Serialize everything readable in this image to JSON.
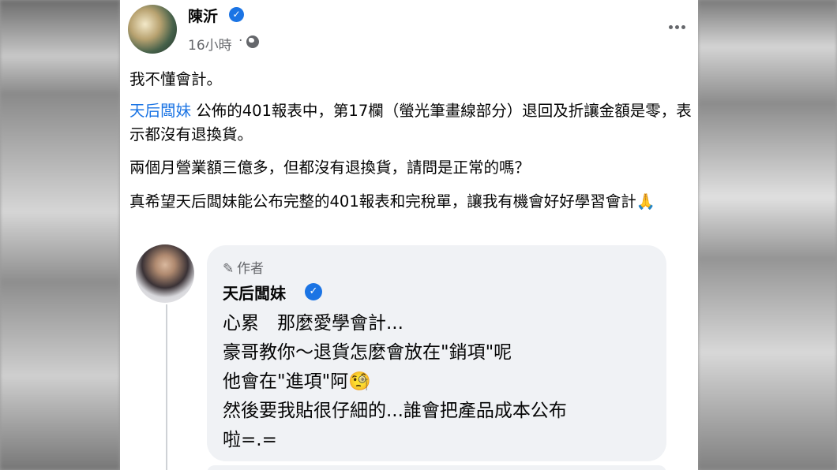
{
  "post": {
    "author": "陳沂",
    "timestamp": "16小時",
    "separator": "·",
    "verified_icon": "verified-check-icon",
    "privacy_icon": "globe-icon",
    "more_icon": "more-options-icon",
    "paragraphs": {
      "p1": "我不懂會計。",
      "p2_mention": "天后闆妹",
      "p2_rest": " 公佈的401報表中，第17欄（螢光筆畫線部分）退回及折讓金額是零，表示都沒有退換貨。",
      "p3": "兩個月營業額三億多，但都沒有退換貨，請問是正常的嗎？",
      "p4": "真希望天后闆妹能公布完整的401報表和完稅單，讓我有機會好好學習會計🙏"
    }
  },
  "comment": {
    "badge_label": "作者",
    "badge_icon": "pencil-icon",
    "author": "天后闆妹",
    "lines": {
      "l1": "心累　那麼愛學會計...",
      "l2": "豪哥教你～退貨怎麼會放在\"銷項\"呢",
      "l3": "他會在\"進項\"阿🧐",
      "l4": "然後要我貼很仔細的...誰會把產品成本公布",
      "l5": "啦=.="
    }
  },
  "colors": {
    "link": "#1b74e4",
    "text": "#050505",
    "secondary": "#65676b",
    "bubble": "#f0f2f5"
  }
}
